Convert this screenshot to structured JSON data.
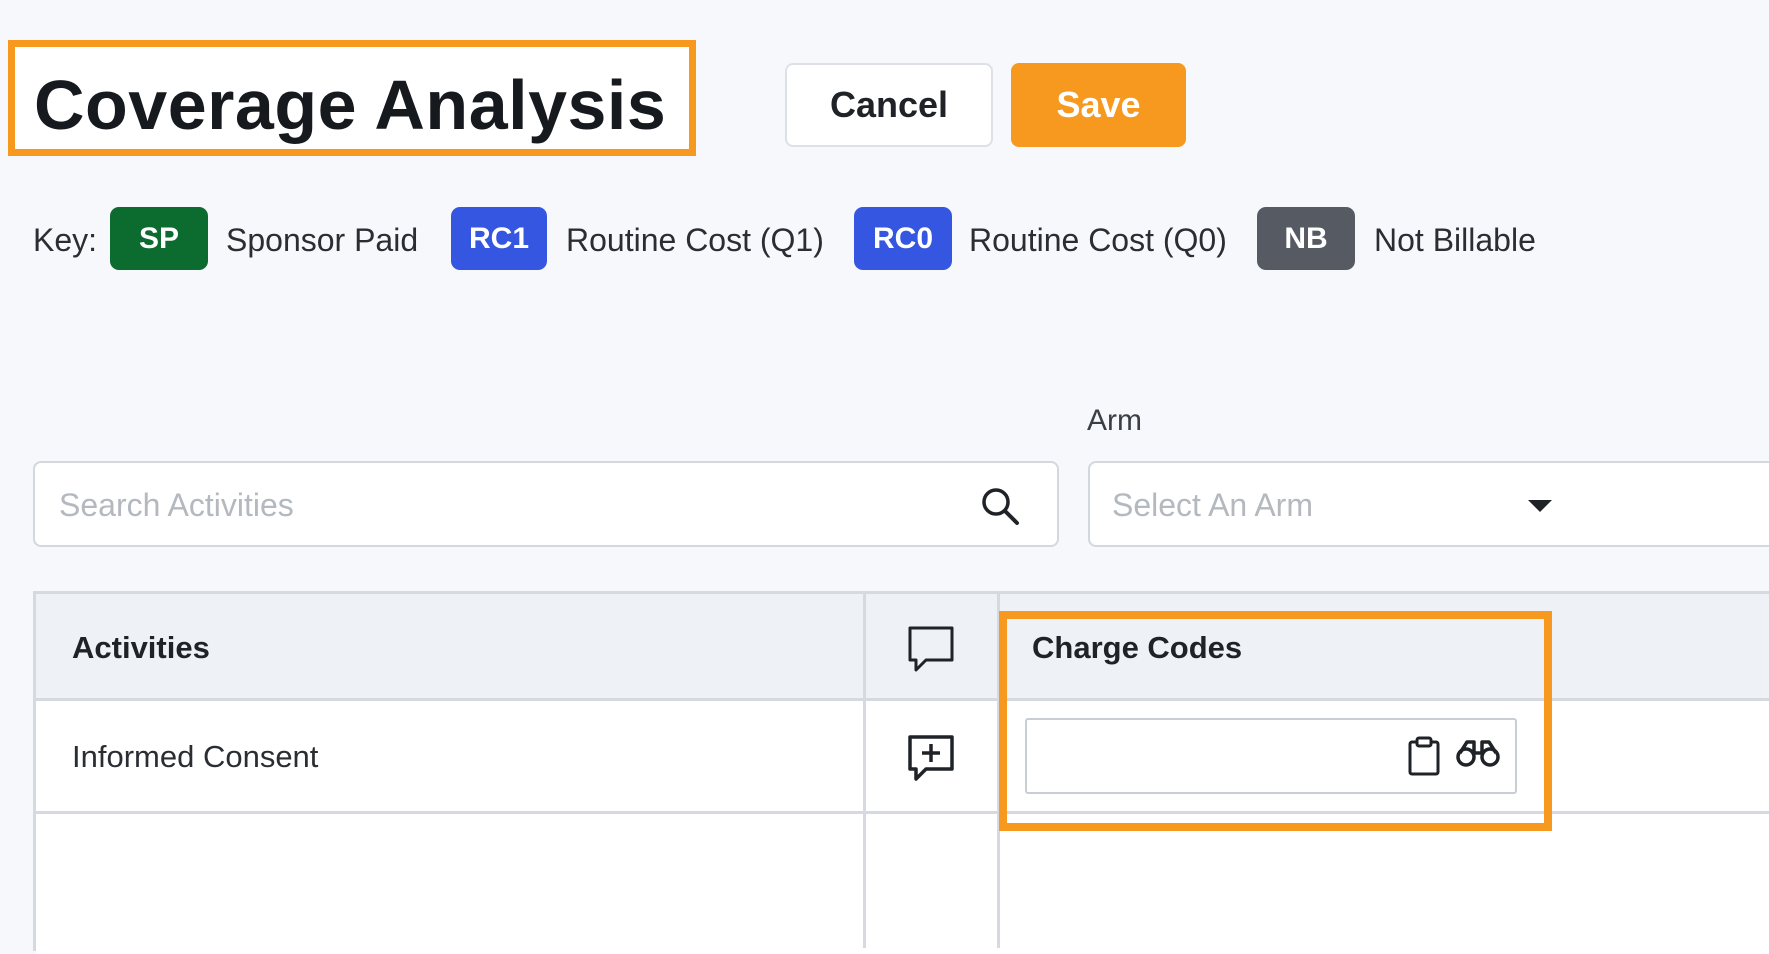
{
  "header": {
    "title": "Coverage Analysis",
    "cancel_label": "Cancel",
    "save_label": "Save"
  },
  "key": {
    "label": "Key:",
    "items": [
      {
        "code": "SP",
        "label": "Sponsor Paid",
        "color": "#0c6b2e"
      },
      {
        "code": "RC1",
        "label": "Routine Cost (Q1)",
        "color": "#3556e0"
      },
      {
        "code": "RC0",
        "label": "Routine Cost (Q0)",
        "color": "#3556e0"
      },
      {
        "code": "NB",
        "label": "Not Billable",
        "color": "#565a62"
      }
    ]
  },
  "search": {
    "placeholder": "Search Activities",
    "icon": "search-icon"
  },
  "arm": {
    "label": "Arm",
    "placeholder": "Select An Arm"
  },
  "table": {
    "columns": {
      "activities": "Activities",
      "comments_icon": "comment-icon",
      "charge_codes": "Charge Codes"
    },
    "rows": [
      {
        "activity": "Informed Consent",
        "charge_code": ""
      }
    ]
  },
  "colors": {
    "accent": "#f7991e",
    "highlight": "#f7991e"
  }
}
